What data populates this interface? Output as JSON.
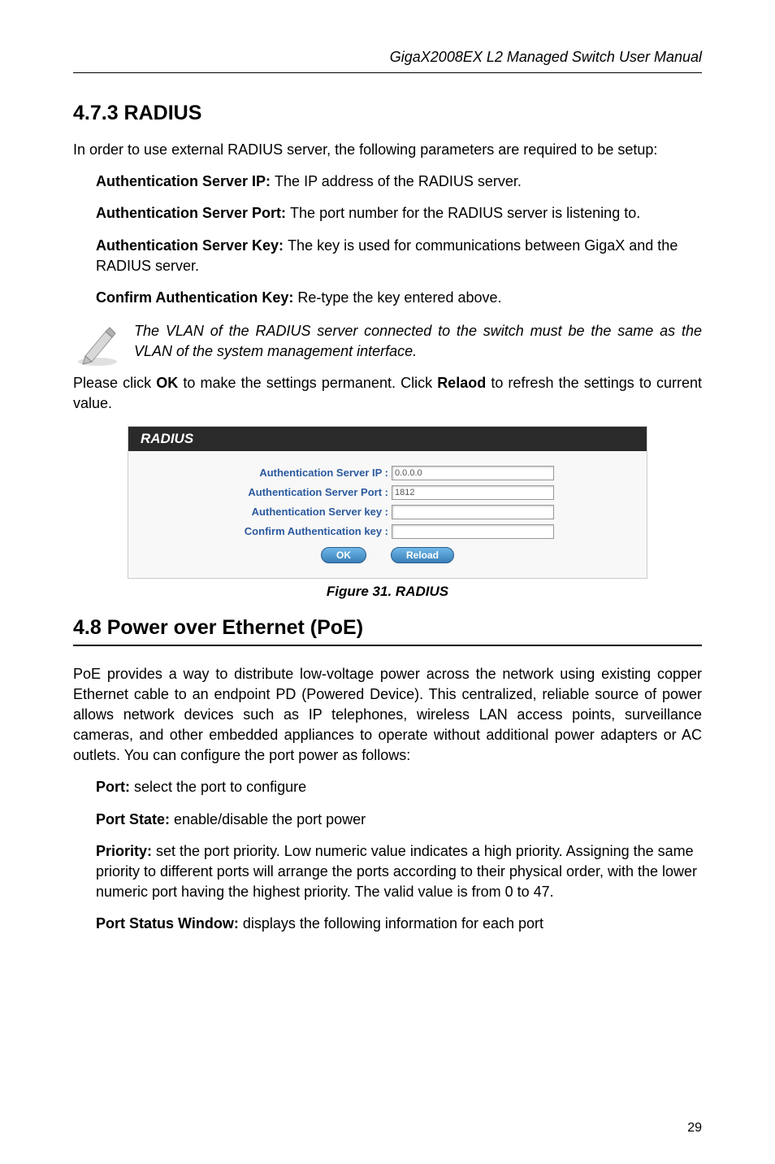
{
  "header": {
    "title": "GigaX2008EX L2 Managed Switch User Manual"
  },
  "section1": {
    "heading": "4.7.3    RADIUS",
    "intro": "In order to use external RADIUS server, the following parameters are required to be setup:",
    "item1_label": "Authentication Server IP: ",
    "item1_text": "The IP address of the RADIUS server.",
    "item2_label": "Authentication Server Port: ",
    "item2_text": "The port number for the RADIUS server is listening to.",
    "item3_label": "Authentication Server Key: ",
    "item3_text": "The key is used for communications between GigaX and the RADIUS server.",
    "item4_label": "Confirm Authentication Key: ",
    "item4_text": "Re-type the key entered above.",
    "note": "The VLAN of the RADIUS server connected  to the switch must be the same as the VLAN of the system management interface.",
    "para2_pre": "Please click ",
    "para2_b1": "OK",
    "para2_mid": " to make the settings permanent. Click ",
    "para2_b2": "Relaod",
    "para2_post": " to refresh the settings to current value."
  },
  "radius": {
    "panel_title": "RADIUS",
    "row1_label": "Authentication Server IP :",
    "row1_value": "0.0.0.0",
    "row2_label": "Authentication Server Port :",
    "row2_value": "1812",
    "row3_label": "Authentication Server key :",
    "row3_value": "",
    "row4_label": "Confirm Authentication key :",
    "row4_value": "",
    "btn_ok": "OK",
    "btn_reload": "Reload",
    "figure_caption": "Figure 31. RADIUS"
  },
  "section2": {
    "heading": "4.8 Power over Ethernet (PoE)",
    "intro": "PoE provides a way to distribute low-voltage power across the network using existing copper Ethernet cable to an endpoint PD (Powered Device). This centralized, reliable source of power allows network devices such as IP telephones, wireless LAN access points, surveillance cameras, and other embedded appliances to operate without additional power adapters or AC outlets. You can configure the port power as follows:",
    "item1_label": "Port: ",
    "item1_text": "select the port to configure",
    "item2_label": "Port State: ",
    "item2_text": "enable/disable the port power",
    "item3_label": "Priority: ",
    "item3_text": "set the port priority. Low numeric value indicates a high priority. Assigning the same priority to different ports will arrange the ports according to their physical order, with the lower numeric port having the highest priority. The valid value is from 0 to 47.",
    "item4_label": "Port Status Window: ",
    "item4_text": "displays the following information for each port"
  },
  "page_number": "29"
}
